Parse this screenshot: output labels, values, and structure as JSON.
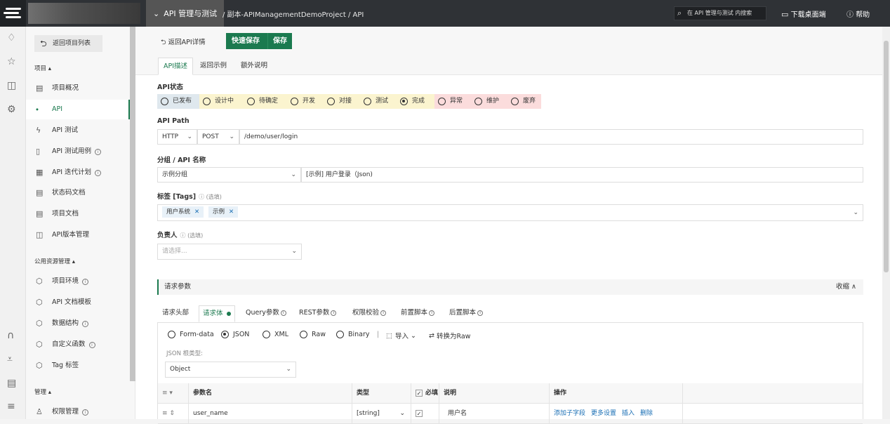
{
  "topbar": {
    "project_label": "API 管理与测试",
    "breadcrumb": "/ 副本-APIManagementDemoProject / API",
    "search_placeholder": "在 API 管理与测试 内搜索",
    "download_label": "下载桌面端",
    "help_label": "帮助"
  },
  "sidebar": {
    "back_label": "返回项目列表",
    "section_project": "项目 ▴",
    "section_public": "公用资源管理 ▴",
    "section_manage": "管理 ▴",
    "items": [
      {
        "label": "项目概况"
      },
      {
        "label": "API"
      },
      {
        "label": "API 测试"
      },
      {
        "label": "API 测试用例"
      },
      {
        "label": "API 迭代计划"
      },
      {
        "label": "状态码文档"
      },
      {
        "label": "项目文档"
      },
      {
        "label": "API版本管理"
      },
      {
        "label": "项目环境"
      },
      {
        "label": "API 文档模板"
      },
      {
        "label": "数据结构"
      },
      {
        "label": "自定义函数"
      },
      {
        "label": "Tag 标签"
      },
      {
        "label": "权限管理"
      }
    ],
    "info_mark": "i"
  },
  "main": {
    "back_label": "返回API详情",
    "quick_save_label": "快速保存",
    "save_label": "保存",
    "tabs": [
      "API描述",
      "返回示例",
      "额外说明"
    ],
    "status_label": "API状态",
    "statuses": [
      "已发布",
      "设计中",
      "待确定",
      "开发",
      "对接",
      "测试",
      "完成",
      "异常",
      "维护",
      "废弃"
    ],
    "path_label": "API Path",
    "protocol": "HTTP",
    "method": "POST",
    "path": "/demo/user/login",
    "group_label": "分组 / API 名称",
    "group": "示例分组",
    "api_name": "[示例] 用户登录（Json)",
    "tags_label": "标签 [Tags]",
    "tags_opt": "(选填)",
    "tags": [
      "用户系统",
      "示例"
    ],
    "owner_label": "负责人",
    "owner_opt": "(选填)",
    "owner_placeholder": "请选择...",
    "req_params_label": "请求参数",
    "collapse_label": "收缩 ∧",
    "req_tabs": [
      "请求头部",
      "请求体",
      "Query参数",
      "REST参数",
      "权限校验",
      "前置脚本",
      "后置脚本"
    ],
    "body_formats": [
      "Form-data",
      "JSON",
      "XML",
      "Raw",
      "Binary"
    ],
    "import_label": "导入",
    "to_raw_label": "转换为Raw",
    "root_type_label": "JSON 根类型:",
    "root_type": "Object",
    "table_headers": {
      "name": "参数名",
      "type": "类型",
      "required": "必填",
      "desc": "说明",
      "ops": "操作"
    },
    "rows": [
      {
        "name": "user_name",
        "type": "[string]",
        "desc": "用户名",
        "ops": [
          "添加子字段",
          "更多设置",
          "插入",
          "删除"
        ]
      }
    ]
  },
  "colors": {
    "accent": "#1b7a4f",
    "topbar": "#2f3236",
    "link": "#1a6fb5"
  }
}
